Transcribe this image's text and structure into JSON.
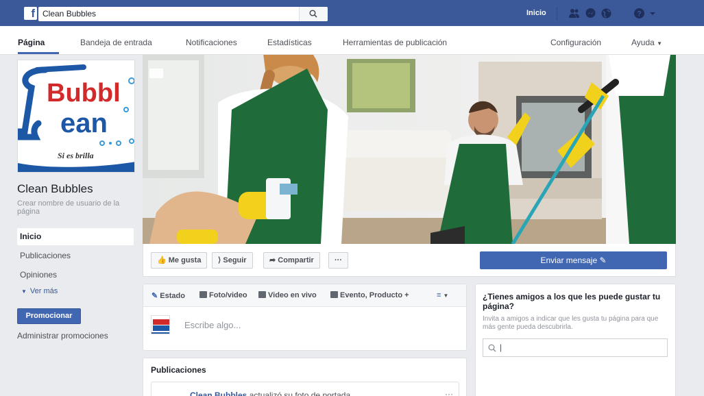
{
  "topbar": {
    "search_value": "Clean Bubbles",
    "home_label": "Inicio",
    "logo": "f",
    "brand_color": "#3b5998",
    "icons": [
      "friends-icon",
      "messenger-icon",
      "globe-icon",
      "help-icon",
      "dropdown-icon"
    ]
  },
  "nav": {
    "tabs": [
      {
        "label": "Página",
        "active": true
      },
      {
        "label": "Bandeja de entrada"
      },
      {
        "label": "Notificaciones"
      },
      {
        "label": "Estadísticas"
      },
      {
        "label": "Herramientas de publicación"
      }
    ],
    "settings": "Configuración",
    "help": "Ayuda"
  },
  "page": {
    "name": "Clean Bubbles",
    "username_prompt": "Crear nombre de usuario de la página",
    "logo_text_1": "Bubbl",
    "logo_text_2": "ean",
    "logo_slogan": "Si es brilla"
  },
  "sidebar": {
    "items": [
      {
        "label": "Inicio",
        "active": true
      },
      {
        "label": "Publicaciones"
      },
      {
        "label": "Opiniones"
      }
    ],
    "more": "Ver más",
    "promote_button": "Promocionar",
    "manage_promotions": "Administrar promociones"
  },
  "actions": {
    "like": "Me gusta",
    "follow": "Seguir",
    "share": "Compartir",
    "more": "···",
    "send_message": "Enviar mensaje"
  },
  "composer": {
    "tabs": [
      {
        "label": "Estado",
        "icon": "pencil-icon"
      },
      {
        "label": "Foto/video",
        "icon": "photo-icon"
      },
      {
        "label": "Video en vivo",
        "icon": "live-video-icon"
      },
      {
        "label": "Evento, Producto +",
        "icon": "event-icon"
      }
    ],
    "placeholder": "Escribe algo..."
  },
  "publications": {
    "title": "Publicaciones",
    "post_author": "Clean Bubbles",
    "post_action": "actualizó su foto de portada.",
    "post_menu": "···"
  },
  "invite": {
    "title": "¿Tienes amigos a los que les puede gustar tu página?",
    "description": "Invita a amigos a indicar que les gusta tu página para que más gente pueda descubrirla.",
    "search_value": "|"
  }
}
